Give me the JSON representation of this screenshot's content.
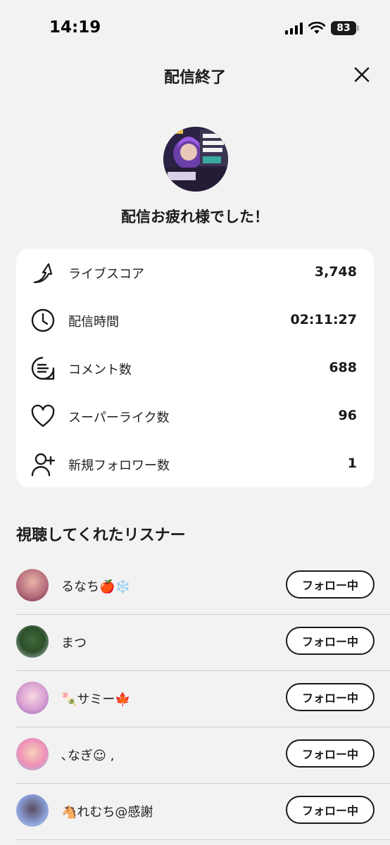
{
  "status_bar": {
    "time": "14:19",
    "battery": "83"
  },
  "header": {
    "title": "配信終了",
    "close_icon": "close-icon"
  },
  "summary": {
    "message": "配信お疲れ様でした！"
  },
  "stats": [
    {
      "icon": "live-score-icon",
      "label": "ライブスコア",
      "value": "3,748"
    },
    {
      "icon": "clock-icon",
      "label": "配信時間",
      "value": "02:11:27"
    },
    {
      "icon": "comment-icon",
      "label": "コメント数",
      "value": "688"
    },
    {
      "icon": "heart-icon",
      "label": "スーパーライク数",
      "value": "96"
    },
    {
      "icon": "add-user-icon",
      "label": "新規フォロワー数",
      "value": "1"
    }
  ],
  "listeners_section": {
    "title": "視聴してくれたリスナー",
    "listeners": [
      {
        "name": "るなち🍎❄️",
        "button": "フォロー中"
      },
      {
        "name": "まつ",
        "button": "フォロー中"
      },
      {
        "name": "🍡サミー🍁",
        "button": "フォロー中"
      },
      {
        "name": "､なぎ☺︎ ‚",
        "button": "フォロー中"
      },
      {
        "name": "🐴れむち@感謝",
        "button": "フォロー中"
      }
    ]
  }
}
